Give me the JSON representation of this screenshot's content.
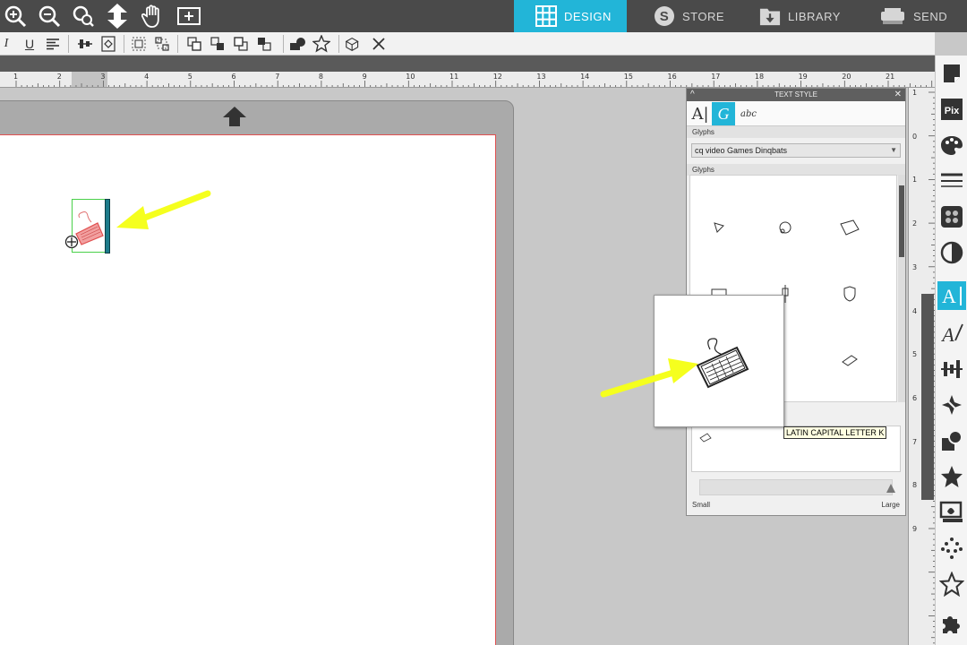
{
  "top_nav": {
    "tabs": [
      {
        "label": "DESIGN",
        "active": true
      },
      {
        "label": "STORE",
        "active": false
      },
      {
        "label": "LIBRARY",
        "active": false
      },
      {
        "label": "SEND",
        "active": false
      }
    ],
    "tools": [
      "zoom-in-icon",
      "zoom-out-icon",
      "zoom-fit-icon",
      "pan-arrows-icon",
      "hand-icon",
      "add-page-icon"
    ]
  },
  "toolbar": {
    "italic": "I",
    "underline": "U"
  },
  "ruler": {
    "top_numbers": [
      "1",
      "2",
      "3",
      "4",
      "5",
      "6",
      "7",
      "8",
      "9",
      "10",
      "11",
      "12",
      "13",
      "14",
      "15",
      "16",
      "17",
      "18",
      "19",
      "20",
      "21"
    ],
    "right_numbers": [
      "1",
      "0",
      "1",
      "2",
      "3",
      "4",
      "5",
      "6",
      "7",
      "8",
      "9"
    ]
  },
  "text_style_panel": {
    "title": "TEXT STYLE",
    "collapse": "^",
    "close": "✕",
    "tabs": [
      "A|",
      "G",
      "abc"
    ],
    "section1": "Glyphs",
    "font_value": "cq video Games Dinqbats",
    "section2": "Glyphs",
    "size_small": "Small",
    "size_large": "Large",
    "size_value": 1.0
  },
  "tooltip": "LATIN CAPITAL LETTER K",
  "colors": {
    "accent": "#22b5d8",
    "topbar": "#4a4a4a",
    "arrow": "#f5ff1e",
    "selection": "#4ad04a"
  }
}
